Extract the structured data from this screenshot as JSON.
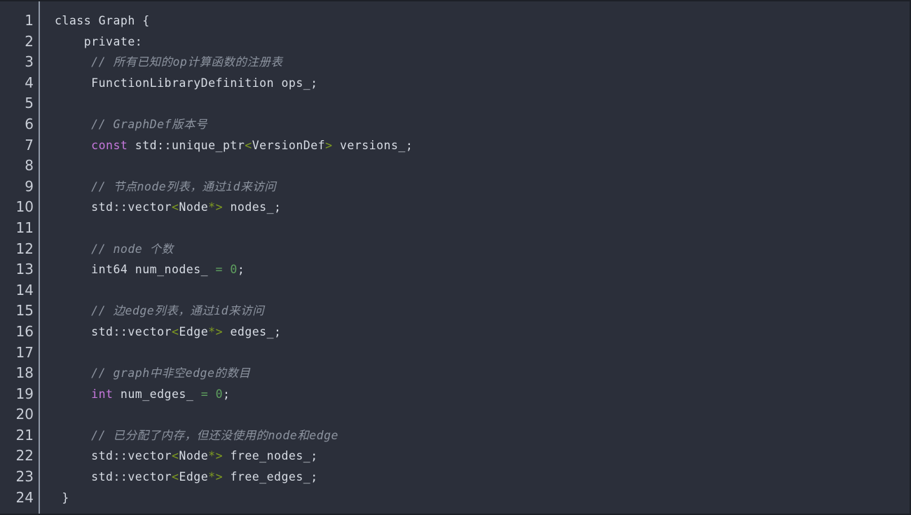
{
  "editor": {
    "language": "cpp",
    "theme": "one-dark",
    "colors": {
      "background": "#2b2f3a",
      "foreground": "#d8dde5",
      "gutter_text": "#c8cdd6",
      "gutter_separator": "#8f98a6",
      "comment": "#8d94a0",
      "keyword": "#c678dd",
      "bracket": "#7f9c20",
      "number": "#5fa05f",
      "border": "#1d2027"
    },
    "first_line": 1,
    "last_line": 24,
    "line_numbers": [
      "1",
      "2",
      "3",
      "4",
      "5",
      "6",
      "7",
      "8",
      "9",
      "10",
      "11",
      "12",
      "13",
      "14",
      "15",
      "16",
      "17",
      "18",
      "19",
      "20",
      "21",
      "22",
      "23",
      "24"
    ],
    "lines": [
      {
        "n": 1,
        "tokens": [
          {
            "t": "class Graph {",
            "c": "plain"
          }
        ]
      },
      {
        "n": 2,
        "tokens": [
          {
            "t": "    private:",
            "c": "plain"
          }
        ]
      },
      {
        "n": 3,
        "tokens": [
          {
            "t": "     // 所有已知的op计算函数的注册表",
            "c": "comment"
          }
        ]
      },
      {
        "n": 4,
        "tokens": [
          {
            "t": "     FunctionLibraryDefinition ops_;",
            "c": "plain"
          }
        ]
      },
      {
        "n": 5,
        "tokens": [
          {
            "t": "",
            "c": "plain"
          }
        ]
      },
      {
        "n": 6,
        "tokens": [
          {
            "t": "     // GraphDef版本号",
            "c": "comment"
          }
        ]
      },
      {
        "n": 7,
        "tokens": [
          {
            "t": "     ",
            "c": "plain"
          },
          {
            "t": "const",
            "c": "keyword"
          },
          {
            "t": " std::unique_ptr",
            "c": "plain"
          },
          {
            "t": "<",
            "c": "bracket"
          },
          {
            "t": "VersionDef",
            "c": "plain"
          },
          {
            "t": ">",
            "c": "bracket"
          },
          {
            "t": " versions_;",
            "c": "plain"
          }
        ]
      },
      {
        "n": 8,
        "tokens": [
          {
            "t": "",
            "c": "plain"
          }
        ]
      },
      {
        "n": 9,
        "tokens": [
          {
            "t": "     // 节点node列表，通过id来访问",
            "c": "comment"
          }
        ]
      },
      {
        "n": 10,
        "tokens": [
          {
            "t": "     std::vector",
            "c": "plain"
          },
          {
            "t": "<",
            "c": "bracket"
          },
          {
            "t": "Node",
            "c": "plain"
          },
          {
            "t": "*>",
            "c": "bracket"
          },
          {
            "t": " nodes_;",
            "c": "plain"
          }
        ]
      },
      {
        "n": 11,
        "tokens": [
          {
            "t": "",
            "c": "plain"
          }
        ]
      },
      {
        "n": 12,
        "tokens": [
          {
            "t": "     // node 个数",
            "c": "comment"
          }
        ]
      },
      {
        "n": 13,
        "tokens": [
          {
            "t": "     int64 num_nodes_ ",
            "c": "plain"
          },
          {
            "t": "=",
            "c": "op"
          },
          {
            "t": " ",
            "c": "plain"
          },
          {
            "t": "0",
            "c": "number"
          },
          {
            "t": ";",
            "c": "plain"
          }
        ]
      },
      {
        "n": 14,
        "tokens": [
          {
            "t": "",
            "c": "plain"
          }
        ]
      },
      {
        "n": 15,
        "tokens": [
          {
            "t": "     // 边edge列表，通过id来访问",
            "c": "comment"
          }
        ]
      },
      {
        "n": 16,
        "tokens": [
          {
            "t": "     std::vector",
            "c": "plain"
          },
          {
            "t": "<",
            "c": "bracket"
          },
          {
            "t": "Edge",
            "c": "plain"
          },
          {
            "t": "*>",
            "c": "bracket"
          },
          {
            "t": " edges_;",
            "c": "plain"
          }
        ]
      },
      {
        "n": 17,
        "tokens": [
          {
            "t": "",
            "c": "plain"
          }
        ]
      },
      {
        "n": 18,
        "tokens": [
          {
            "t": "     // graph中非空edge的数目",
            "c": "comment"
          }
        ]
      },
      {
        "n": 19,
        "tokens": [
          {
            "t": "     ",
            "c": "plain"
          },
          {
            "t": "int",
            "c": "keyword"
          },
          {
            "t": " num_edges_ ",
            "c": "plain"
          },
          {
            "t": "=",
            "c": "op"
          },
          {
            "t": " ",
            "c": "plain"
          },
          {
            "t": "0",
            "c": "number"
          },
          {
            "t": ";",
            "c": "plain"
          }
        ]
      },
      {
        "n": 20,
        "tokens": [
          {
            "t": "",
            "c": "plain"
          }
        ]
      },
      {
        "n": 21,
        "tokens": [
          {
            "t": "     // 已分配了内存，但还没使用的node和edge",
            "c": "comment"
          }
        ]
      },
      {
        "n": 22,
        "tokens": [
          {
            "t": "     std::vector",
            "c": "plain"
          },
          {
            "t": "<",
            "c": "bracket"
          },
          {
            "t": "Node",
            "c": "plain"
          },
          {
            "t": "*>",
            "c": "bracket"
          },
          {
            "t": " free_nodes_;",
            "c": "plain"
          }
        ]
      },
      {
        "n": 23,
        "tokens": [
          {
            "t": "     std::vector",
            "c": "plain"
          },
          {
            "t": "<",
            "c": "bracket"
          },
          {
            "t": "Edge",
            "c": "plain"
          },
          {
            "t": "*>",
            "c": "bracket"
          },
          {
            "t": " free_edges_;",
            "c": "plain"
          }
        ]
      },
      {
        "n": 24,
        "tokens": [
          {
            "t": " }",
            "c": "plain"
          }
        ]
      }
    ]
  }
}
